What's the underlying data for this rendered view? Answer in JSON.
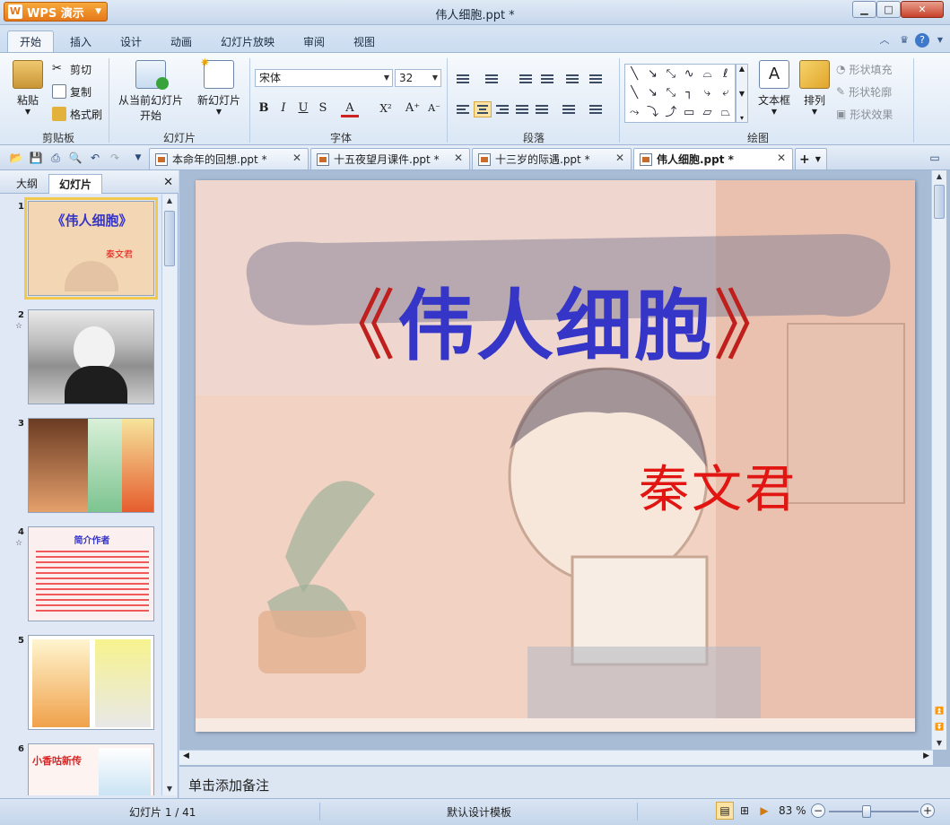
{
  "app": {
    "name": "WPS 演示",
    "window_title": "伟人细胞.ppt *"
  },
  "ribbon_tabs": [
    "开始",
    "插入",
    "设计",
    "动画",
    "幻灯片放映",
    "审阅",
    "视图"
  ],
  "ribbon": {
    "clipboard": {
      "paste": "粘贴",
      "cut": "剪切",
      "copy": "复制",
      "format_painter": "格式刷",
      "label": "剪贴板"
    },
    "slides": {
      "from_current_line1": "从当前幻灯片",
      "from_current_line2": "开始",
      "new_slide": "新幻灯片",
      "label": "幻灯片"
    },
    "font": {
      "name": "宋体",
      "size": "32",
      "label": "字体",
      "bold": "B",
      "italic": "I",
      "underline": "U",
      "shadow": "S"
    },
    "paragraph": {
      "label": "段落"
    },
    "drawing": {
      "textbox": "文本框",
      "arrange": "排列",
      "shape_fill": "形状填充",
      "shape_outline": "形状轮廓",
      "shape_effects": "形状效果",
      "label": "绘图"
    }
  },
  "doc_tabs": [
    {
      "title": "本命年的回想.ppt *",
      "active": false
    },
    {
      "title": "十五夜望月课件.ppt *",
      "active": false
    },
    {
      "title": "十三岁的际遇.ppt *",
      "active": false
    },
    {
      "title": "伟人细胞.ppt *",
      "active": true
    }
  ],
  "panel": {
    "tabs": [
      "大纲",
      "幻灯片"
    ],
    "active_tab": "幻灯片",
    "thumbnails": [
      {
        "number": "1",
        "title": "《伟人细胞》",
        "author": "秦文君",
        "selected": true,
        "star": false
      },
      {
        "number": "2",
        "selected": false,
        "star": true
      },
      {
        "number": "3",
        "selected": false,
        "star": false
      },
      {
        "number": "4",
        "title": "简介作者",
        "selected": false,
        "star": true
      },
      {
        "number": "5",
        "selected": false,
        "star": false
      },
      {
        "number": "6",
        "title": "小香咕新传",
        "selected": false,
        "star": false
      }
    ]
  },
  "slide": {
    "title_open": "《",
    "title_main": "伟人细胞",
    "title_close": "》",
    "author": "秦文君"
  },
  "notes_placeholder": "单击添加备注",
  "status": {
    "slide_info": "幻灯片 1 / 41",
    "template": "默认设计模板",
    "zoom": "83 %",
    "zoom_level": 0.83
  },
  "colors": {
    "title_blue": "#3535c8",
    "author_red": "#e11512",
    "bracket_red": "#c0201d",
    "wps_orange": "#e5781b"
  }
}
